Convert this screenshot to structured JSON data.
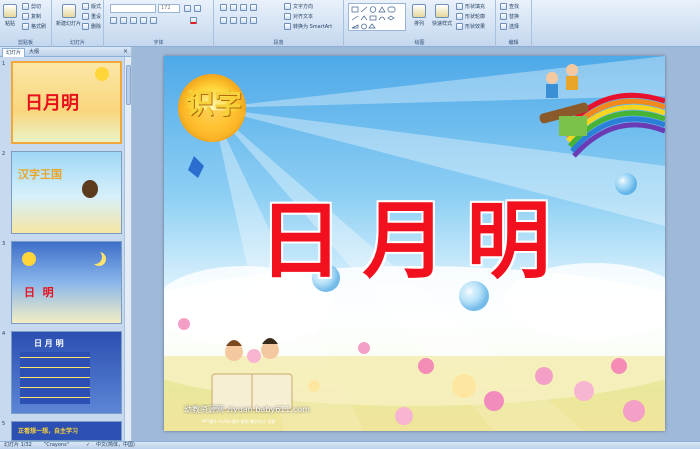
{
  "ribbon": {
    "clipboard": {
      "paste": "粘贴",
      "cut": "剪切",
      "copy": "复制",
      "format_painter": "格式刷",
      "label": "剪贴板"
    },
    "slides": {
      "new_slide": "新建幻灯片",
      "layout": "版式",
      "reset": "重设",
      "delete": "删除",
      "label": "幻灯片"
    },
    "font": {
      "font_size": "172",
      "label": "字体"
    },
    "paragraph": {
      "text_direction": "文字方向",
      "align_text": "对齐文本",
      "smartart": "转换为 SmartArt",
      "label": "段落"
    },
    "drawing": {
      "arrange": "排列",
      "quick_styles": "快速样式",
      "shape_fill": "形状填充",
      "shape_outline": "形状轮廓",
      "shape_effects": "形状效果",
      "label": "绘图"
    },
    "editing": {
      "find": "查找",
      "replace": "替换",
      "select": "选择",
      "label": "编辑"
    }
  },
  "pane": {
    "tabs": [
      "幻灯片",
      "大纲"
    ],
    "close": "×",
    "thumbnails": [
      {
        "num": "1",
        "title": "日月明"
      },
      {
        "num": "2",
        "title": "汉字王国"
      },
      {
        "num": "3",
        "title": "日  明"
      },
      {
        "num": "4",
        "title": "日 月 明"
      },
      {
        "num": "5",
        "title": "正看想一想，自主学习"
      }
    ]
  },
  "slide": {
    "title": "日月明",
    "badge": "识字",
    "footer": "幼教资源网 ziyuan.baby611.com",
    "footer_sub": "PPT课件 FLASH课件 教案 教学设计 试卷"
  },
  "status": {
    "slide_count": "幻灯片 1/32",
    "theme": "\"Crayons\"",
    "language": "中文(简体，中国)"
  },
  "colors": {
    "title": "#f2101e",
    "selected_border": "#f1a83a"
  }
}
